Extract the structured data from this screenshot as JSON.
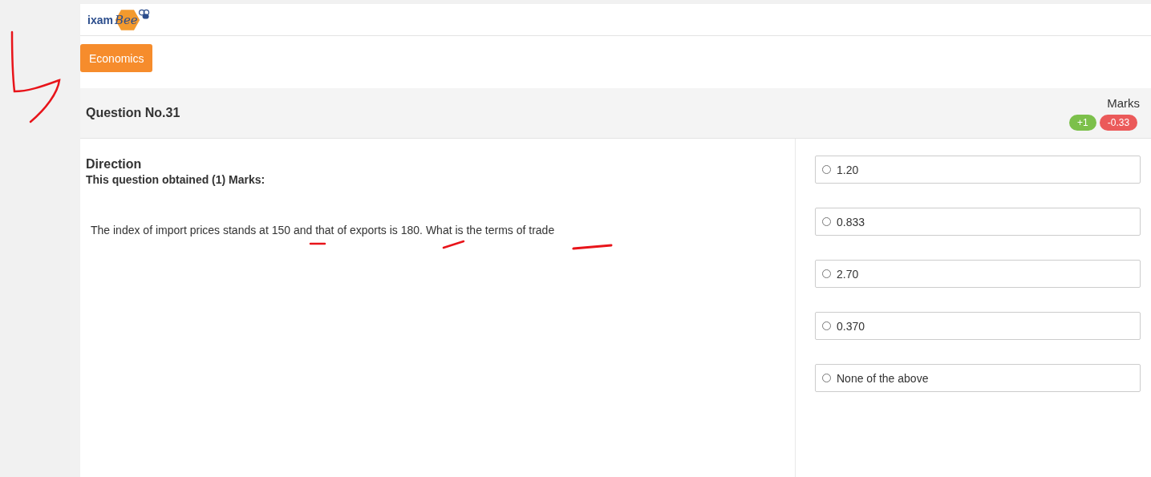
{
  "logo": {
    "text": "ixam",
    "script_text": "Bee"
  },
  "subject_tab": {
    "label": "Economics",
    "selected": true
  },
  "question_header": {
    "title": "Question No.31",
    "marks_label": "Marks",
    "marks": [
      {
        "text": "+1",
        "kind": "positive"
      },
      {
        "text": "-0.33",
        "kind": "negative"
      }
    ]
  },
  "direction": {
    "title": "Direction",
    "obtained": "This question obtained (1) Marks:",
    "question": "The index of import prices stands at 150 and that of exports is 180. What is the terms of trade"
  },
  "options": [
    {
      "label": "1.20",
      "selected": false
    },
    {
      "label": "0.833",
      "selected": false
    },
    {
      "label": "2.70",
      "selected": false
    },
    {
      "label": "0.370",
      "selected": false
    },
    {
      "label": "None of the above",
      "selected": false
    }
  ]
}
